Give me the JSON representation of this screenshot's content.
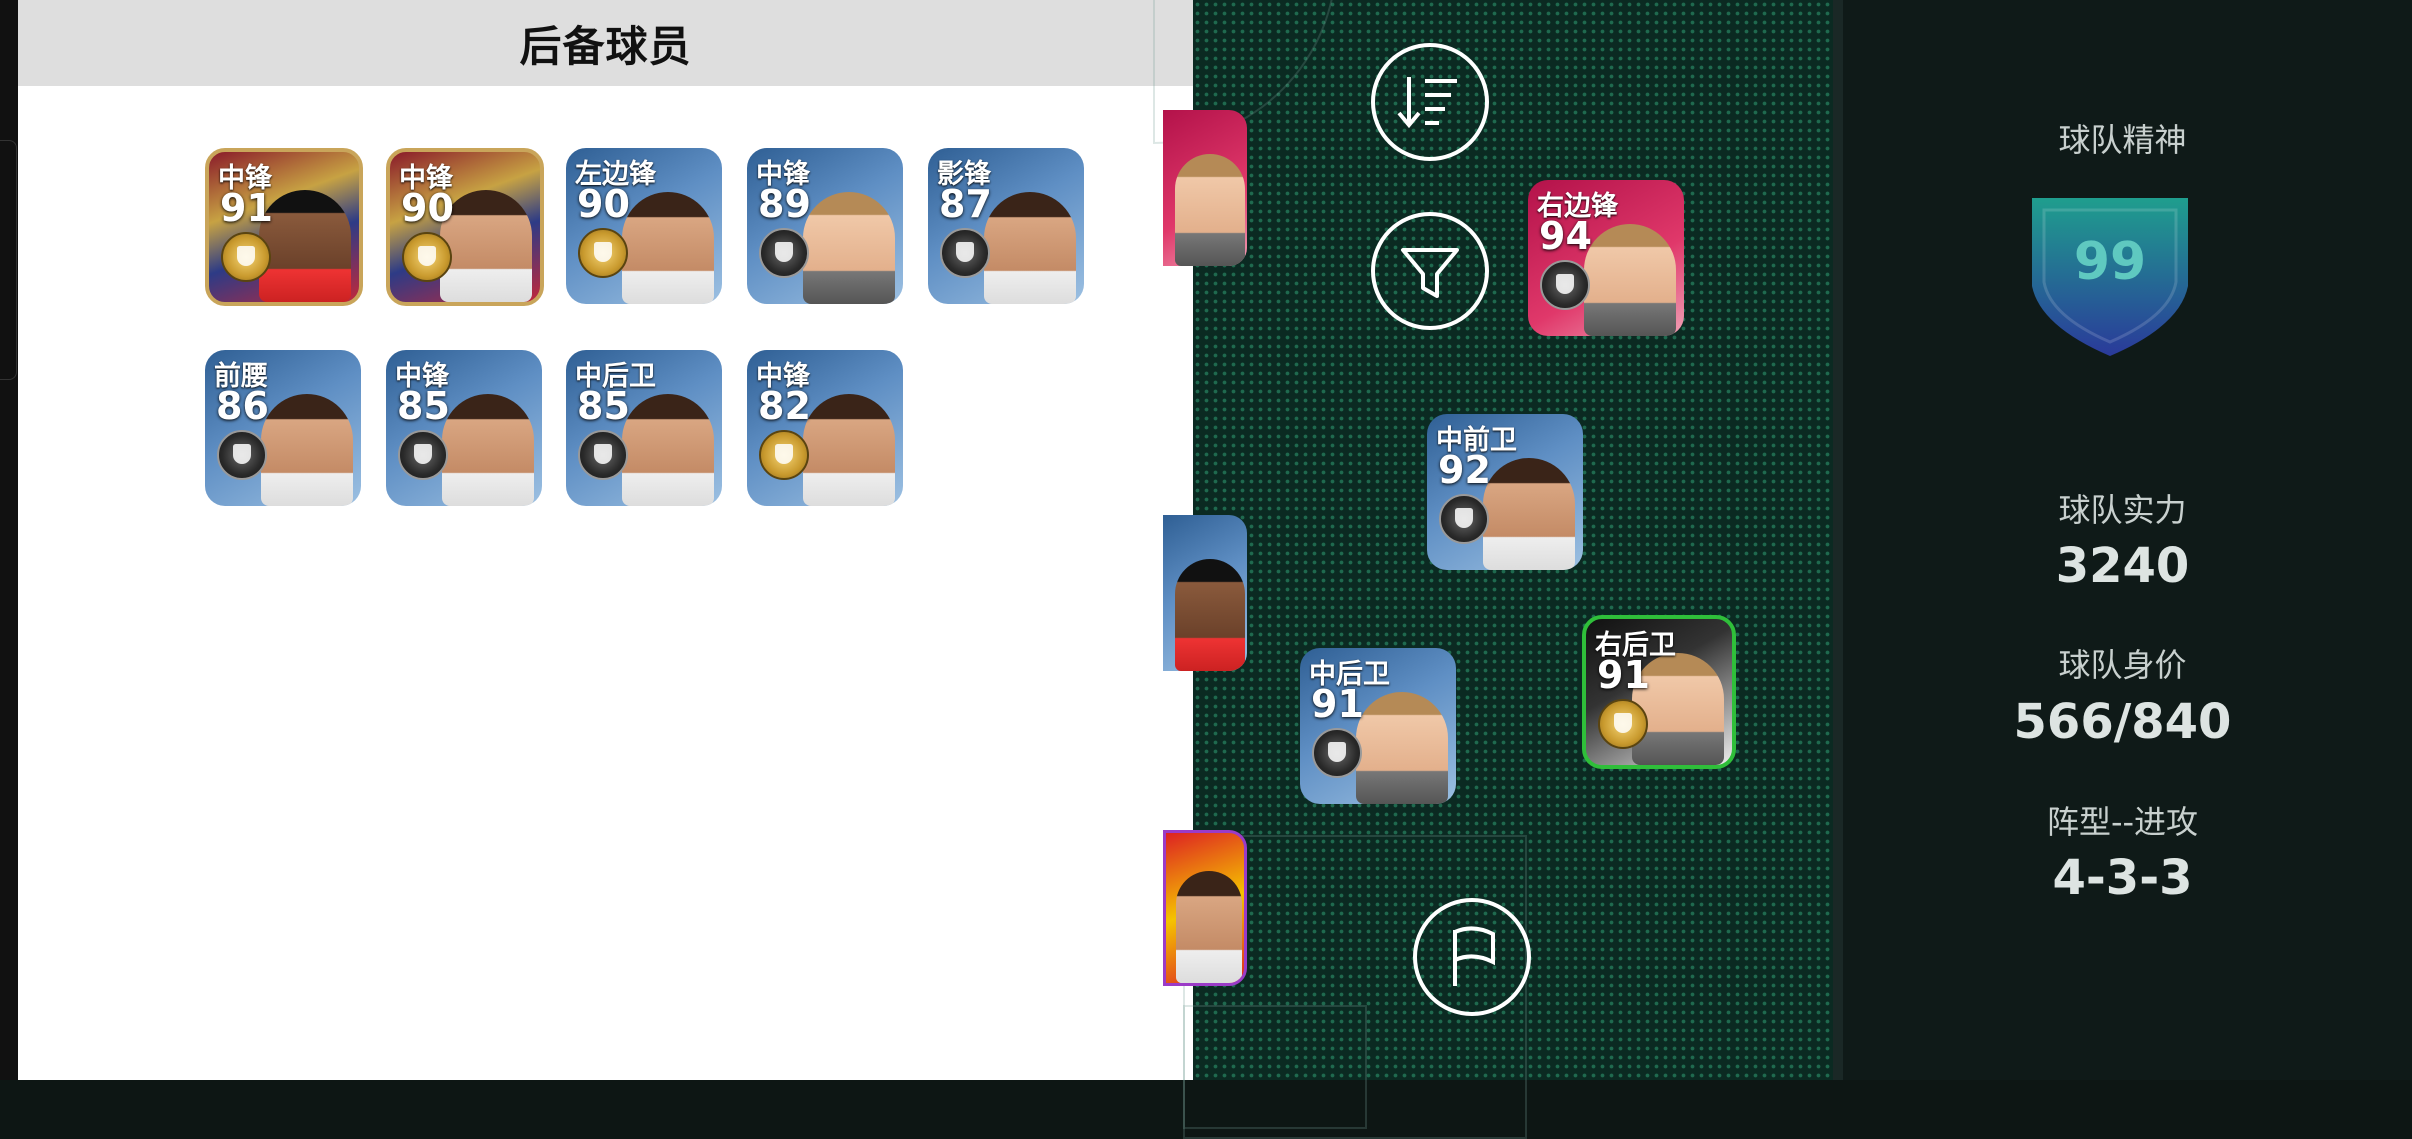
{
  "reserve": {
    "title": "后备球员",
    "players": [
      {
        "position": "中锋",
        "rating": "91"
      },
      {
        "position": "中锋",
        "rating": "90"
      },
      {
        "position": "左边锋",
        "rating": "90"
      },
      {
        "position": "中锋",
        "rating": "89"
      },
      {
        "position": "影锋",
        "rating": "87"
      },
      {
        "position": "前腰",
        "rating": "86"
      },
      {
        "position": "中锋",
        "rating": "85"
      },
      {
        "position": "中后卫",
        "rating": "85"
      },
      {
        "position": "中锋",
        "rating": "82"
      }
    ]
  },
  "pitch": {
    "controls": {
      "sort_icon": "sort-icon",
      "filter_icon": "filter-icon",
      "flag_icon": "flag-icon"
    },
    "players": [
      {
        "position": "右边锋",
        "rating": "94"
      },
      {
        "position": "中前卫",
        "rating": "92"
      },
      {
        "position": "中后卫",
        "rating": "91"
      },
      {
        "position": "右后卫",
        "rating": "91"
      }
    ]
  },
  "team": {
    "spirit_label": "球队精神",
    "spirit_value": "99",
    "strength_label": "球队实力",
    "strength_value": "3240",
    "value_label": "球队身价",
    "value_value": "566/840",
    "formation_label": "阵型--进攻",
    "formation_value": "4-3-3"
  },
  "colors": {
    "accent_green": "#2fbf3a",
    "shield_teal": "#1f9e8e"
  }
}
